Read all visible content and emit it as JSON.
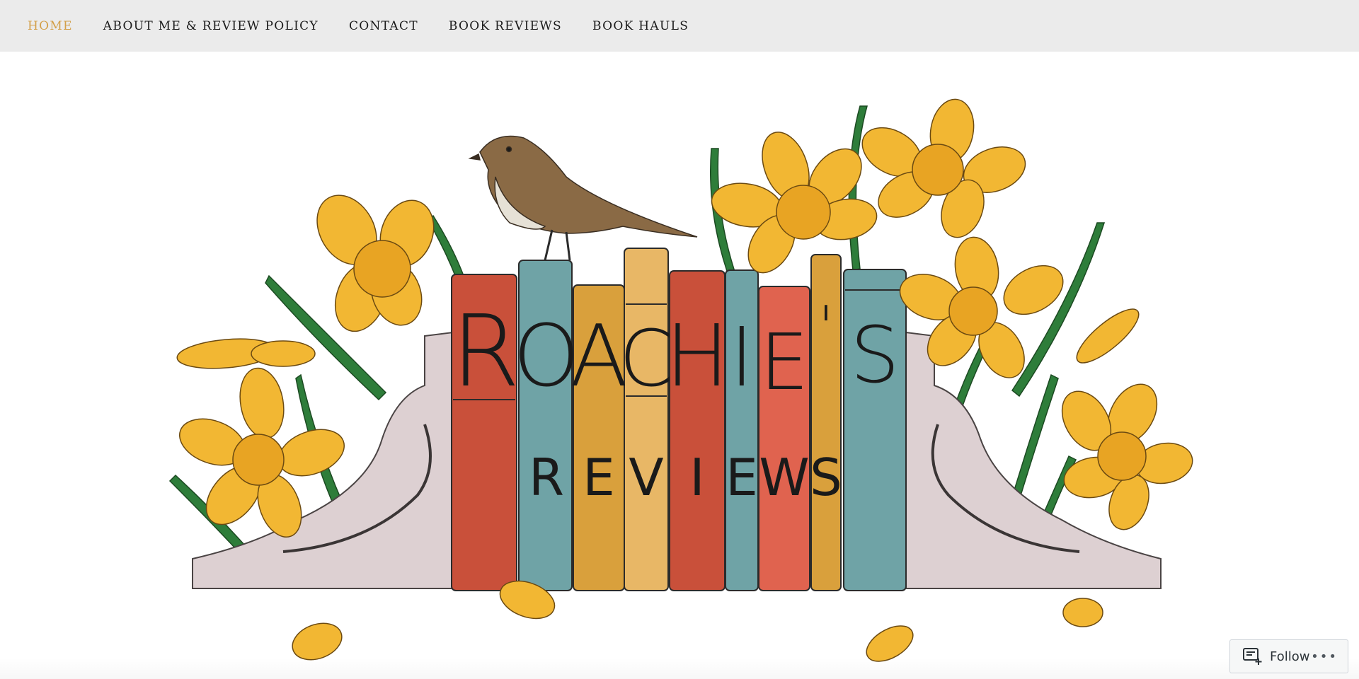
{
  "nav": {
    "items": [
      {
        "label": "HOME",
        "active": true
      },
      {
        "label": "ABOUT ME & REVIEW POLICY",
        "active": false
      },
      {
        "label": "CONTACT",
        "active": false
      },
      {
        "label": "BOOK REVIEWS",
        "active": false
      },
      {
        "label": "BOOK HAULS",
        "active": false
      }
    ]
  },
  "header_art": {
    "title_line1": "ROACHIE'S",
    "title_line2": "REVIEWS",
    "spine_letters": [
      "R",
      "O",
      "A",
      "C",
      "H",
      "I",
      "E",
      "'",
      "S"
    ],
    "subtitle_letters": [
      "R",
      "E",
      "V",
      "I",
      "E",
      "W",
      "S"
    ],
    "motif": [
      "bookends",
      "bird",
      "daffodils",
      "falling petals"
    ]
  },
  "follow": {
    "label": "Follow",
    "more_label": "•••",
    "icon": "reader-follow-icon"
  },
  "colors": {
    "nav_bg": "#ebebeb",
    "nav_active": "#d3a04a",
    "book_red": "#c9503a",
    "book_teal": "#6fa3a6",
    "book_ochre": "#d9a03c",
    "book_cream": "#e8b766",
    "book_salmon": "#e0634f",
    "daffodil": "#f2b733",
    "leaf": "#2e7d3a",
    "bookend_stone": "#ddd0d2"
  }
}
